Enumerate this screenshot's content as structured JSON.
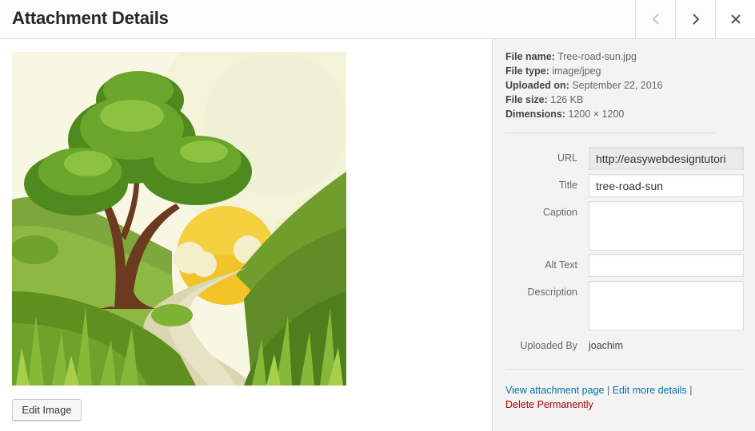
{
  "header": {
    "title": "Attachment Details",
    "prev_icon": "chevron-left-icon",
    "next_icon": "chevron-right-icon",
    "close_icon": "close-icon"
  },
  "media": {
    "edit_button_label": "Edit Image"
  },
  "file_info": {
    "file_name_label": "File name:",
    "file_name": "Tree-road-sun.jpg",
    "file_type_label": "File type:",
    "file_type": "image/jpeg",
    "uploaded_on_label": "Uploaded on:",
    "uploaded_on": "September 22, 2016",
    "file_size_label": "File size:",
    "file_size": "126 KB",
    "dimensions_label": "Dimensions:",
    "dimensions": "1200 × 1200"
  },
  "fields": {
    "url_label": "URL",
    "url_value": "http://easywebdesigntutori",
    "title_label": "Title",
    "title_value": "tree-road-sun",
    "caption_label": "Caption",
    "caption_value": "",
    "alt_label": "Alt Text",
    "alt_value": "",
    "description_label": "Description",
    "description_value": "",
    "uploaded_by_label": "Uploaded By",
    "uploaded_by_value": "joachim"
  },
  "actions": {
    "view_label": "View attachment page",
    "separator": "|",
    "edit_more_label": "Edit more details",
    "delete_label": "Delete Permanently"
  },
  "colors": {
    "link": "#0073aa",
    "delete": "#aa0000",
    "sidebar_bg": "#f3f3f3"
  }
}
